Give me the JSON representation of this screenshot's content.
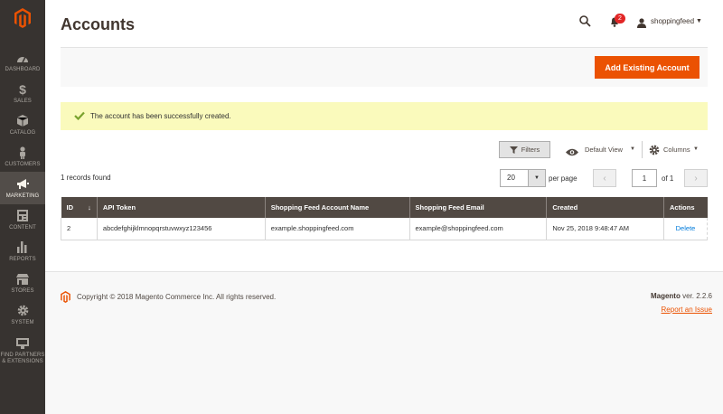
{
  "colors": {
    "accent": "#eb5202",
    "sidebar": "#373330",
    "header": "#514943",
    "message_bg": "#fafabc",
    "link": "#007bdb"
  },
  "sidebar": {
    "items": [
      {
        "label": "DASHBOARD",
        "icon": "dashboard-icon"
      },
      {
        "label": "SALES",
        "icon": "dollar-icon"
      },
      {
        "label": "CATALOG",
        "icon": "cube-icon"
      },
      {
        "label": "CUSTOMERS",
        "icon": "person-icon"
      },
      {
        "label": "MARKETING",
        "icon": "megaphone-icon"
      },
      {
        "label": "CONTENT",
        "icon": "content-icon"
      },
      {
        "label": "REPORTS",
        "icon": "bar-chart-icon"
      },
      {
        "label": "STORES",
        "icon": "store-icon"
      },
      {
        "label": "SYSTEM",
        "icon": "gear-icon"
      },
      {
        "label": "FIND PARTNERS",
        "label2": "& EXTENSIONS",
        "icon": "partners-icon"
      }
    ],
    "active": "MARKETING"
  },
  "header": {
    "title": "Accounts",
    "notifications_count": "2",
    "user": "shoppingfeed"
  },
  "actions": {
    "add_existing": "Add Existing Account"
  },
  "message": {
    "text": "The account has been successfully created."
  },
  "grid": {
    "filters_label": "Filters",
    "view_label": "Default View",
    "columns_label": "Columns",
    "records_found": "1 records found",
    "per_page_value": "20",
    "per_page_label": "per page",
    "current_page": "1",
    "of_pages": "of 1",
    "columns": [
      "ID",
      "API Token",
      "Shopping Feed Account Name",
      "Shopping Feed Email",
      "Created",
      "Actions"
    ],
    "rows": [
      {
        "id": "2",
        "token": "abcdefghijklmnopqrstuvwxyz123456",
        "name": "example.shoppingfeed.com",
        "email": "example@shoppingfeed.com",
        "created": "Nov 25, 2018 9:48:47 AM",
        "action": "Delete"
      }
    ]
  },
  "footer": {
    "copyright": "Copyright © 2018 Magento Commerce Inc. All rights reserved.",
    "brand": "Magento",
    "version": " ver. 2.2.6",
    "report": "Report an Issue"
  }
}
